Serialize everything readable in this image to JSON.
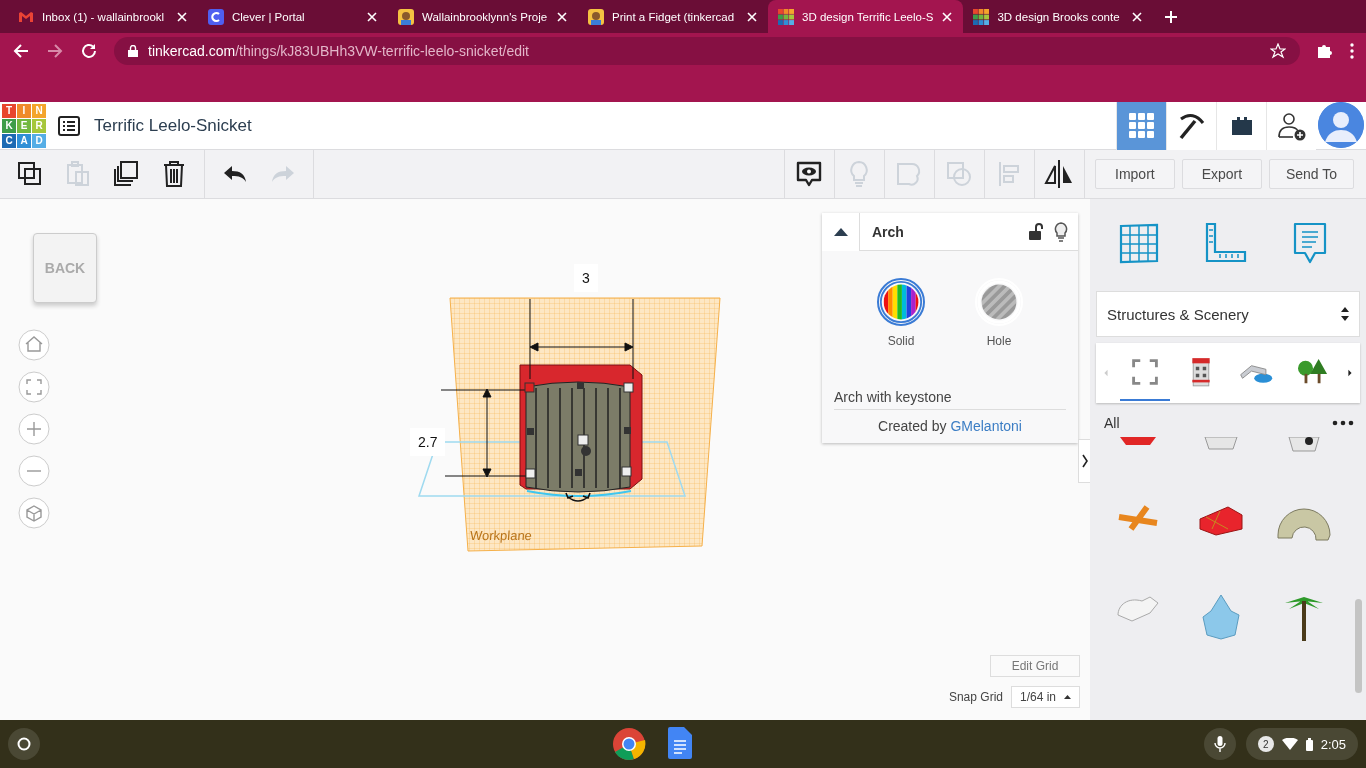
{
  "browser": {
    "tabs": [
      {
        "kind": "gmail",
        "title": "Inbox (1) - wallainbrookl",
        "selected": false
      },
      {
        "kind": "clever",
        "title": "Clever | Portal",
        "selected": false
      },
      {
        "kind": "avatar",
        "title": "Wallainbrooklynn's Proje",
        "selected": false
      },
      {
        "kind": "avatar",
        "title": "Print a Fidget (tinkercad",
        "selected": false
      },
      {
        "kind": "tinkercad",
        "title": "3D design Terrific Leelo-S",
        "selected": true
      },
      {
        "kind": "tinkercad",
        "title": "3D design Brooks conte",
        "selected": false
      }
    ],
    "address": {
      "domain": "tinkercad.com",
      "path": "/things/kJ83UBHh3VW-terrific-leelo-snicket/edit"
    }
  },
  "app": {
    "logo": [
      "T",
      "I",
      "N",
      "K",
      "E",
      "R",
      "C",
      "A",
      "D"
    ],
    "title": "Terrific Leelo-Snicket",
    "nav": [
      {
        "kind": "grid",
        "selected": true
      },
      {
        "kind": "pickaxe",
        "selected": false
      },
      {
        "kind": "bricks",
        "selected": false
      },
      {
        "kind": "add-user",
        "selected": false
      }
    ]
  },
  "toolbar": {
    "tool_groups": [
      [
        {
          "kind": "copy",
          "disabled": false
        },
        {
          "kind": "paste",
          "disabled": true
        },
        {
          "kind": "duplicate",
          "disabled": false
        },
        {
          "kind": "delete",
          "disabled": false
        }
      ],
      [
        {
          "kind": "undo",
          "disabled": false
        },
        {
          "kind": "redo",
          "disabled": true
        }
      ]
    ],
    "view_tools": [
      {
        "kind": "notes",
        "disabled": false
      },
      {
        "kind": "bulb",
        "disabled": true
      },
      {
        "kind": "group",
        "disabled": true
      },
      {
        "kind": "ungroup",
        "disabled": true
      },
      {
        "kind": "align",
        "disabled": true
      },
      {
        "kind": "mirror",
        "disabled": false
      }
    ],
    "buttons": [
      "Import",
      "Export",
      "Send To"
    ]
  },
  "viewcube": {
    "face": "BACK"
  },
  "workspace": {
    "width_label": "3",
    "height_label": "2.7",
    "workplane_label": "Workplane"
  },
  "inspector": {
    "title": "Arch",
    "locked": false,
    "options": [
      {
        "kind": "solid",
        "label": "Solid",
        "selected": true
      },
      {
        "kind": "hole",
        "label": "Hole",
        "selected": false
      }
    ],
    "description": "Arch with keystone",
    "credit": "Created by",
    "author": "GMelantoni"
  },
  "shapes_panel": {
    "category": "Structures & Scenery",
    "subcategories": [
      {
        "kind": "all",
        "selected": true
      },
      {
        "kind": "building",
        "selected": false
      },
      {
        "kind": "bridge",
        "selected": false
      },
      {
        "kind": "trees",
        "selected": false
      }
    ],
    "filter": "All"
  },
  "grid": {
    "edit": "Edit Grid",
    "snap_label": "Snap Grid",
    "snap_value": "1/64 in"
  },
  "shelf": {
    "notifications": "2",
    "time": "2:05"
  }
}
